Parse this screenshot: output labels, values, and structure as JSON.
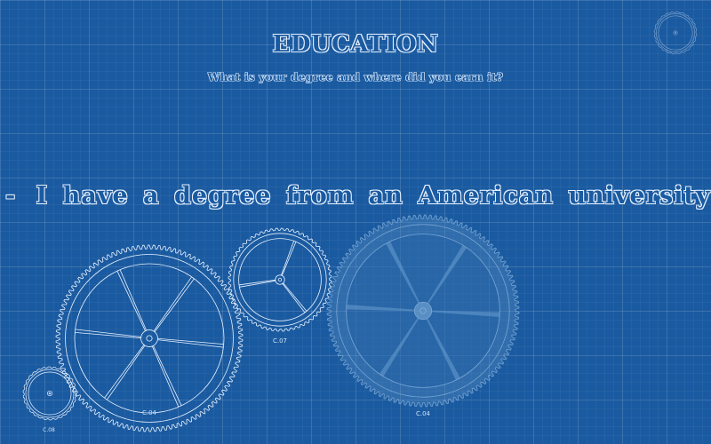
{
  "header": {
    "title": "EDUCATION",
    "subtitle": "What is your degree and where did you earn it?"
  },
  "answer": {
    "dash_left": "-",
    "text": "I have a degree from an American university",
    "dash_right": "-"
  },
  "gears": {
    "large_left_label": "C.04",
    "small_left_label": "C.08",
    "mid_label": "C.07",
    "right_label": "C.04"
  },
  "colors": {
    "background": "#1a5aa0",
    "line": "#e8f2ff",
    "highlight_gear": "#5f93c4"
  }
}
